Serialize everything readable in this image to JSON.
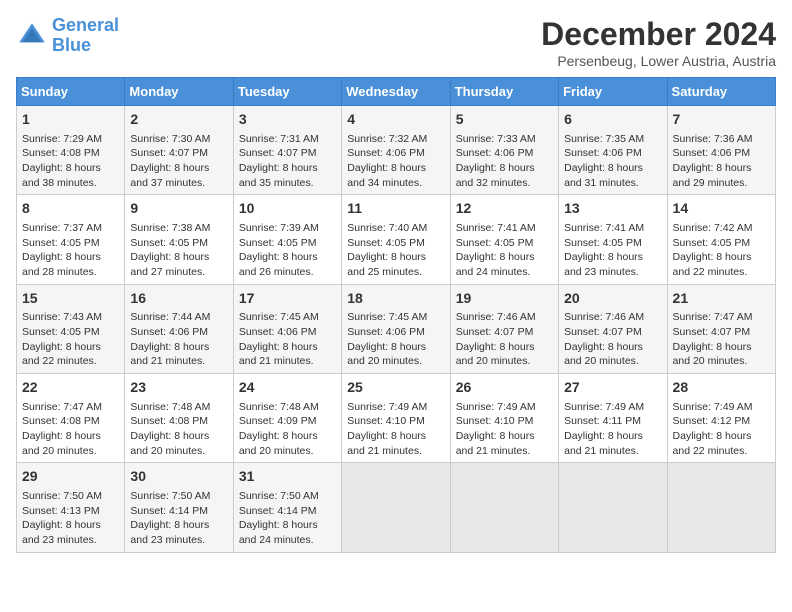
{
  "header": {
    "logo_line1": "General",
    "logo_line2": "Blue",
    "month": "December 2024",
    "location": "Persenbeug, Lower Austria, Austria"
  },
  "days_of_week": [
    "Sunday",
    "Monday",
    "Tuesday",
    "Wednesday",
    "Thursday",
    "Friday",
    "Saturday"
  ],
  "weeks": [
    [
      {
        "day": "1",
        "info": "Sunrise: 7:29 AM\nSunset: 4:08 PM\nDaylight: 8 hours\nand 38 minutes."
      },
      {
        "day": "2",
        "info": "Sunrise: 7:30 AM\nSunset: 4:07 PM\nDaylight: 8 hours\nand 37 minutes."
      },
      {
        "day": "3",
        "info": "Sunrise: 7:31 AM\nSunset: 4:07 PM\nDaylight: 8 hours\nand 35 minutes."
      },
      {
        "day": "4",
        "info": "Sunrise: 7:32 AM\nSunset: 4:06 PM\nDaylight: 8 hours\nand 34 minutes."
      },
      {
        "day": "5",
        "info": "Sunrise: 7:33 AM\nSunset: 4:06 PM\nDaylight: 8 hours\nand 32 minutes."
      },
      {
        "day": "6",
        "info": "Sunrise: 7:35 AM\nSunset: 4:06 PM\nDaylight: 8 hours\nand 31 minutes."
      },
      {
        "day": "7",
        "info": "Sunrise: 7:36 AM\nSunset: 4:06 PM\nDaylight: 8 hours\nand 29 minutes."
      }
    ],
    [
      {
        "day": "8",
        "info": "Sunrise: 7:37 AM\nSunset: 4:05 PM\nDaylight: 8 hours\nand 28 minutes."
      },
      {
        "day": "9",
        "info": "Sunrise: 7:38 AM\nSunset: 4:05 PM\nDaylight: 8 hours\nand 27 minutes."
      },
      {
        "day": "10",
        "info": "Sunrise: 7:39 AM\nSunset: 4:05 PM\nDaylight: 8 hours\nand 26 minutes."
      },
      {
        "day": "11",
        "info": "Sunrise: 7:40 AM\nSunset: 4:05 PM\nDaylight: 8 hours\nand 25 minutes."
      },
      {
        "day": "12",
        "info": "Sunrise: 7:41 AM\nSunset: 4:05 PM\nDaylight: 8 hours\nand 24 minutes."
      },
      {
        "day": "13",
        "info": "Sunrise: 7:41 AM\nSunset: 4:05 PM\nDaylight: 8 hours\nand 23 minutes."
      },
      {
        "day": "14",
        "info": "Sunrise: 7:42 AM\nSunset: 4:05 PM\nDaylight: 8 hours\nand 22 minutes."
      }
    ],
    [
      {
        "day": "15",
        "info": "Sunrise: 7:43 AM\nSunset: 4:05 PM\nDaylight: 8 hours\nand 22 minutes."
      },
      {
        "day": "16",
        "info": "Sunrise: 7:44 AM\nSunset: 4:06 PM\nDaylight: 8 hours\nand 21 minutes."
      },
      {
        "day": "17",
        "info": "Sunrise: 7:45 AM\nSunset: 4:06 PM\nDaylight: 8 hours\nand 21 minutes."
      },
      {
        "day": "18",
        "info": "Sunrise: 7:45 AM\nSunset: 4:06 PM\nDaylight: 8 hours\nand 20 minutes."
      },
      {
        "day": "19",
        "info": "Sunrise: 7:46 AM\nSunset: 4:07 PM\nDaylight: 8 hours\nand 20 minutes."
      },
      {
        "day": "20",
        "info": "Sunrise: 7:46 AM\nSunset: 4:07 PM\nDaylight: 8 hours\nand 20 minutes."
      },
      {
        "day": "21",
        "info": "Sunrise: 7:47 AM\nSunset: 4:07 PM\nDaylight: 8 hours\nand 20 minutes."
      }
    ],
    [
      {
        "day": "22",
        "info": "Sunrise: 7:47 AM\nSunset: 4:08 PM\nDaylight: 8 hours\nand 20 minutes."
      },
      {
        "day": "23",
        "info": "Sunrise: 7:48 AM\nSunset: 4:08 PM\nDaylight: 8 hours\nand 20 minutes."
      },
      {
        "day": "24",
        "info": "Sunrise: 7:48 AM\nSunset: 4:09 PM\nDaylight: 8 hours\nand 20 minutes."
      },
      {
        "day": "25",
        "info": "Sunrise: 7:49 AM\nSunset: 4:10 PM\nDaylight: 8 hours\nand 21 minutes."
      },
      {
        "day": "26",
        "info": "Sunrise: 7:49 AM\nSunset: 4:10 PM\nDaylight: 8 hours\nand 21 minutes."
      },
      {
        "day": "27",
        "info": "Sunrise: 7:49 AM\nSunset: 4:11 PM\nDaylight: 8 hours\nand 21 minutes."
      },
      {
        "day": "28",
        "info": "Sunrise: 7:49 AM\nSunset: 4:12 PM\nDaylight: 8 hours\nand 22 minutes."
      }
    ],
    [
      {
        "day": "29",
        "info": "Sunrise: 7:50 AM\nSunset: 4:13 PM\nDaylight: 8 hours\nand 23 minutes."
      },
      {
        "day": "30",
        "info": "Sunrise: 7:50 AM\nSunset: 4:14 PM\nDaylight: 8 hours\nand 23 minutes."
      },
      {
        "day": "31",
        "info": "Sunrise: 7:50 AM\nSunset: 4:14 PM\nDaylight: 8 hours\nand 24 minutes."
      },
      {
        "day": "",
        "info": ""
      },
      {
        "day": "",
        "info": ""
      },
      {
        "day": "",
        "info": ""
      },
      {
        "day": "",
        "info": ""
      }
    ]
  ]
}
